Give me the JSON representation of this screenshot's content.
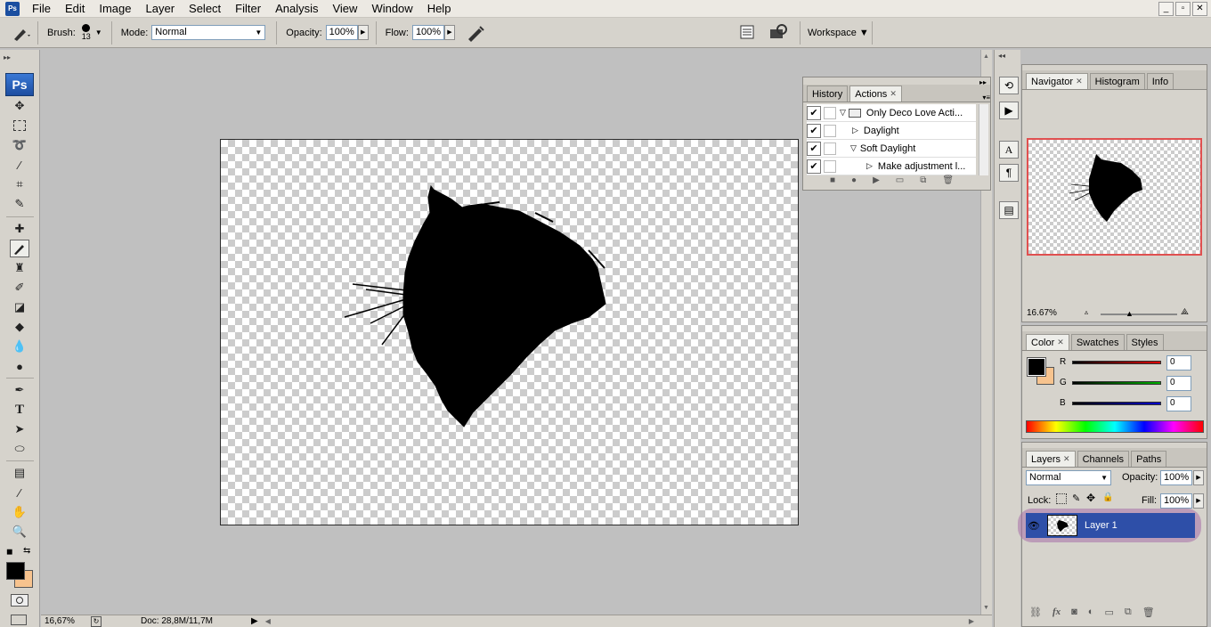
{
  "app": {
    "logo": "Ps"
  },
  "menu": [
    "File",
    "Edit",
    "Image",
    "Layer",
    "Select",
    "Filter",
    "Analysis",
    "View",
    "Window",
    "Help"
  ],
  "window_controls": [
    "_",
    "▫",
    "✕"
  ],
  "options": {
    "brush_label": "Brush:",
    "brush_size": "13",
    "mode_label": "Mode:",
    "mode_value": "Normal",
    "opacity_label": "Opacity:",
    "opacity_value": "100%",
    "flow_label": "Flow:",
    "flow_value": "100%",
    "workspace_label": "Workspace ▼"
  },
  "status": {
    "zoom": "16,67%",
    "doc": "Doc: 28,8M/11,7M"
  },
  "actions_panel": {
    "tabs": [
      "History",
      "Actions"
    ],
    "rows": [
      {
        "label": "Only Deco Love Acti...",
        "checked": true,
        "indent": 0,
        "expanded": true,
        "folder": true
      },
      {
        "label": "Daylight",
        "checked": true,
        "indent": 1,
        "expanded": false
      },
      {
        "label": "Soft Daylight",
        "checked": true,
        "indent": 1,
        "expanded": true
      },
      {
        "label": "Make adjustment l...",
        "checked": true,
        "indent": 2,
        "expanded": false
      }
    ]
  },
  "navigator": {
    "tabs": [
      "Navigator",
      "Histogram",
      "Info"
    ],
    "zoom": "16.67%",
    "frame_color": "#e05050"
  },
  "color_panel": {
    "tabs": [
      "Color",
      "Swatches",
      "Styles"
    ],
    "channels": [
      {
        "label": "R",
        "value": "0",
        "color": "#e00000"
      },
      {
        "label": "G",
        "value": "0",
        "color": "#00b000"
      },
      {
        "label": "B",
        "value": "0",
        "color": "#0000d0"
      }
    ],
    "foreground": "#000000",
    "background": "#f7c38e"
  },
  "layers_panel": {
    "tabs": [
      "Layers",
      "Channels",
      "Paths"
    ],
    "blend_mode": "Normal",
    "opacity_label": "Opacity:",
    "opacity_value": "100%",
    "lock_label": "Lock:",
    "fill_label": "Fill:",
    "fill_value": "100%",
    "layers": [
      {
        "name": "Layer 1",
        "visible": true,
        "selected": true
      }
    ],
    "highlight_color": "#a86fa8",
    "selected_color": "#2e4fa8"
  }
}
